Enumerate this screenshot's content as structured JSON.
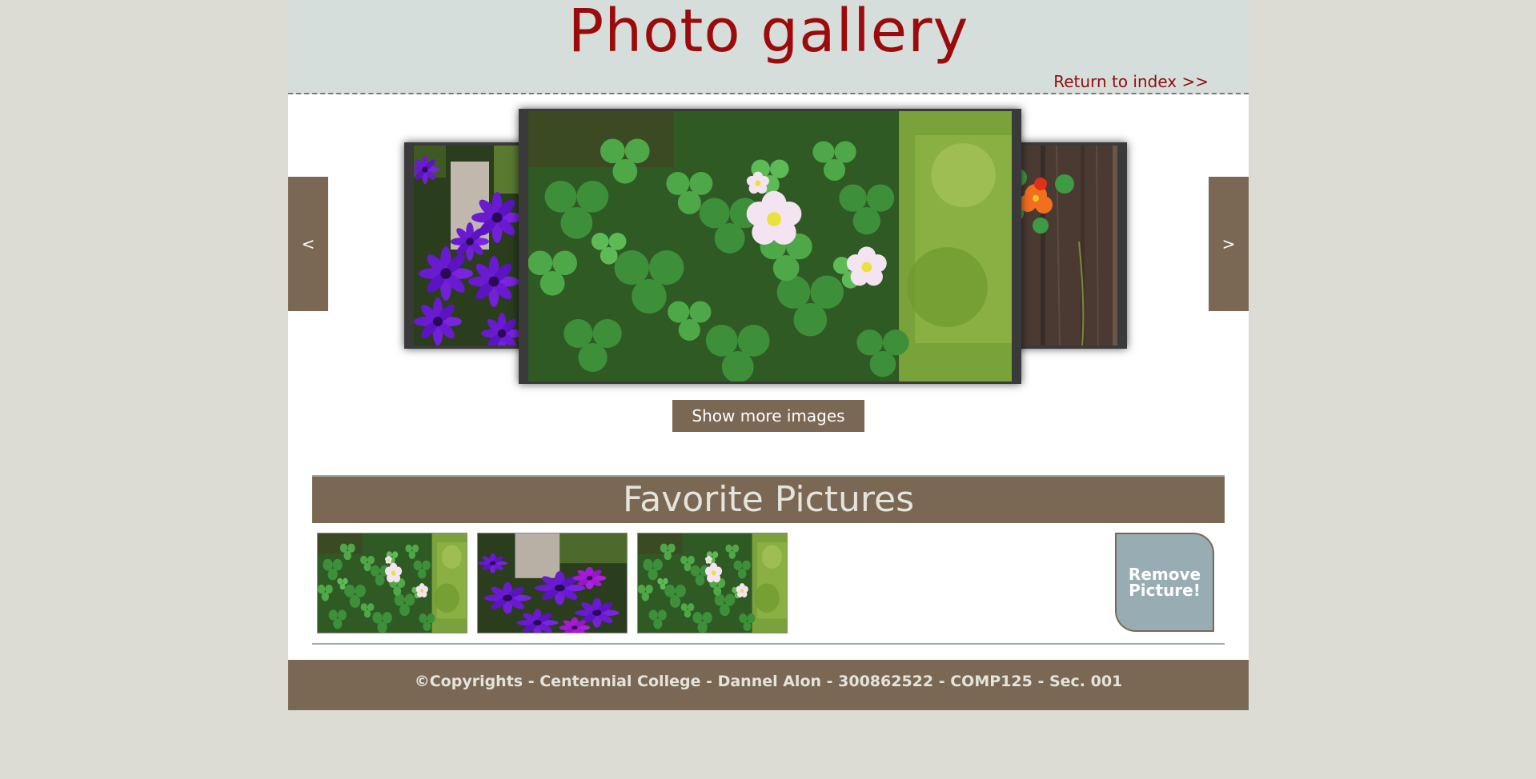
{
  "header": {
    "title": "Photo gallery",
    "return_link": "Return to index >>"
  },
  "carousel": {
    "prev_label": "<",
    "next_label": ">",
    "show_more_label": "Show more images",
    "slides": [
      "purple-flowers",
      "clover-with-pink-flowers",
      "orange-nasturtium"
    ]
  },
  "favorites": {
    "title": "Favorite Pictures",
    "remove_label": "Remove\nPicture!",
    "thumbnails": [
      "clover-with-pink-flowers",
      "purple-flowers",
      "clover-with-pink-flowers"
    ]
  },
  "footer": {
    "copyright": "©Copyrights - Centennial College - Dannel Alon - 300862522 - COMP125 - Sec. 001"
  },
  "colors": {
    "page_background": "#dcdcd4",
    "header_background": "#d6dedb",
    "title": "#9b0b0b",
    "accent_brown": "#7a6855",
    "remove_button": "#97adb3"
  }
}
